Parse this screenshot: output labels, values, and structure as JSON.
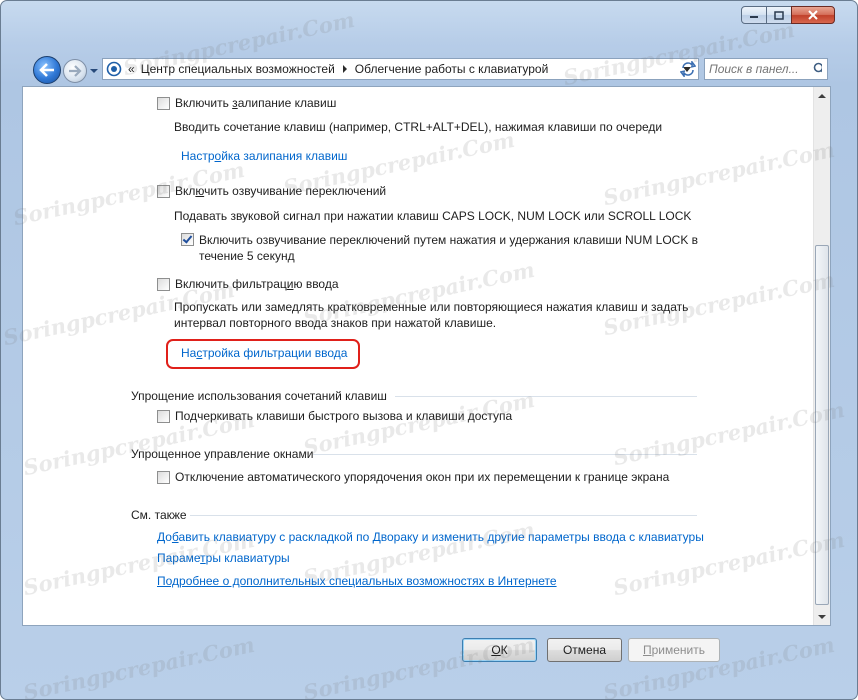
{
  "address": {
    "segments": [
      "Центр специальных возможностей",
      "Облегчение работы с клавиатурой"
    ]
  },
  "search": {
    "placeholder": "Поиск в панел..."
  },
  "sticky_keys": {
    "checkbox_label_pre": "Включить ",
    "checkbox_label_ul": "з",
    "checkbox_label_post": "алипание клавиш",
    "checked": false,
    "description": "Вводить сочетание клавиш (например, CTRL+ALT+DEL), нажимая клавиши по очереди",
    "link_pre": "Настр",
    "link_ul": "о",
    "link_post": "йка залипания клавиш"
  },
  "toggle_keys": {
    "checkbox_label_pre": "Вкл",
    "checkbox_label_ul": "ю",
    "checkbox_label_post": "чить озвучивание переключений",
    "checked": false,
    "description": "Подавать звуковой сигнал при нажатии клавиш CAPS LOCK, NUM LOCK или SCROLL LOCK",
    "sub_checkbox_line1": "Включить озвучивание переключений путем нажатия и удержания клавиши NUM LOCK в",
    "sub_checkbox_line2": "течение 5 секунд",
    "sub_checked": true
  },
  "filter_keys": {
    "checkbox_label_pre": "Включить фильтрац",
    "checkbox_label_ul": "и",
    "checkbox_label_post": "ю ввода",
    "checked": false,
    "description_line1": "Пропускать или замедлять кратковременные или повторяющиеся нажатия клавиш и задать",
    "description_line2": "интервал повторного ввода знаков при нажатой клавише.",
    "link_pre": "На",
    "link_ul": "с",
    "link_post": "тройка фильтрации ввода"
  },
  "shortcuts_section": {
    "heading": "Упрощение использования сочетаний клавиш",
    "checkbox_label_pre": "По",
    "checkbox_label_ul": "д",
    "checkbox_label_post": "черкивать клавиши быстрого вызова и клавиши доступа",
    "checked": false
  },
  "window_mgmt_section": {
    "heading": "Упрощенное управление окнами",
    "checkbox_label": "Отключение автоматического упорядочения окон при их перемещении к границе экрана",
    "checked": false
  },
  "see_also": {
    "heading": "См. также",
    "link1_pre": "До",
    "link1_ul": "б",
    "link1_post": "авить клавиатуру с раскладкой по Двораку и изменить другие параметры ввода с клавиатуры",
    "link2_pre": "Параме",
    "link2_ul": "т",
    "link2_post": "ры клавиатуры",
    "link3": "Подробнее о дополнительных специальных возможностях в Интернете"
  },
  "buttons": {
    "ok_ul": "О",
    "ok_post": "К",
    "cancel": "Отмена",
    "apply_ul": "П",
    "apply_post": "рименить"
  },
  "watermark": "Soringpcrepair.Com",
  "colors": {
    "link": "#0066cc",
    "highlight": "#e0201a"
  }
}
